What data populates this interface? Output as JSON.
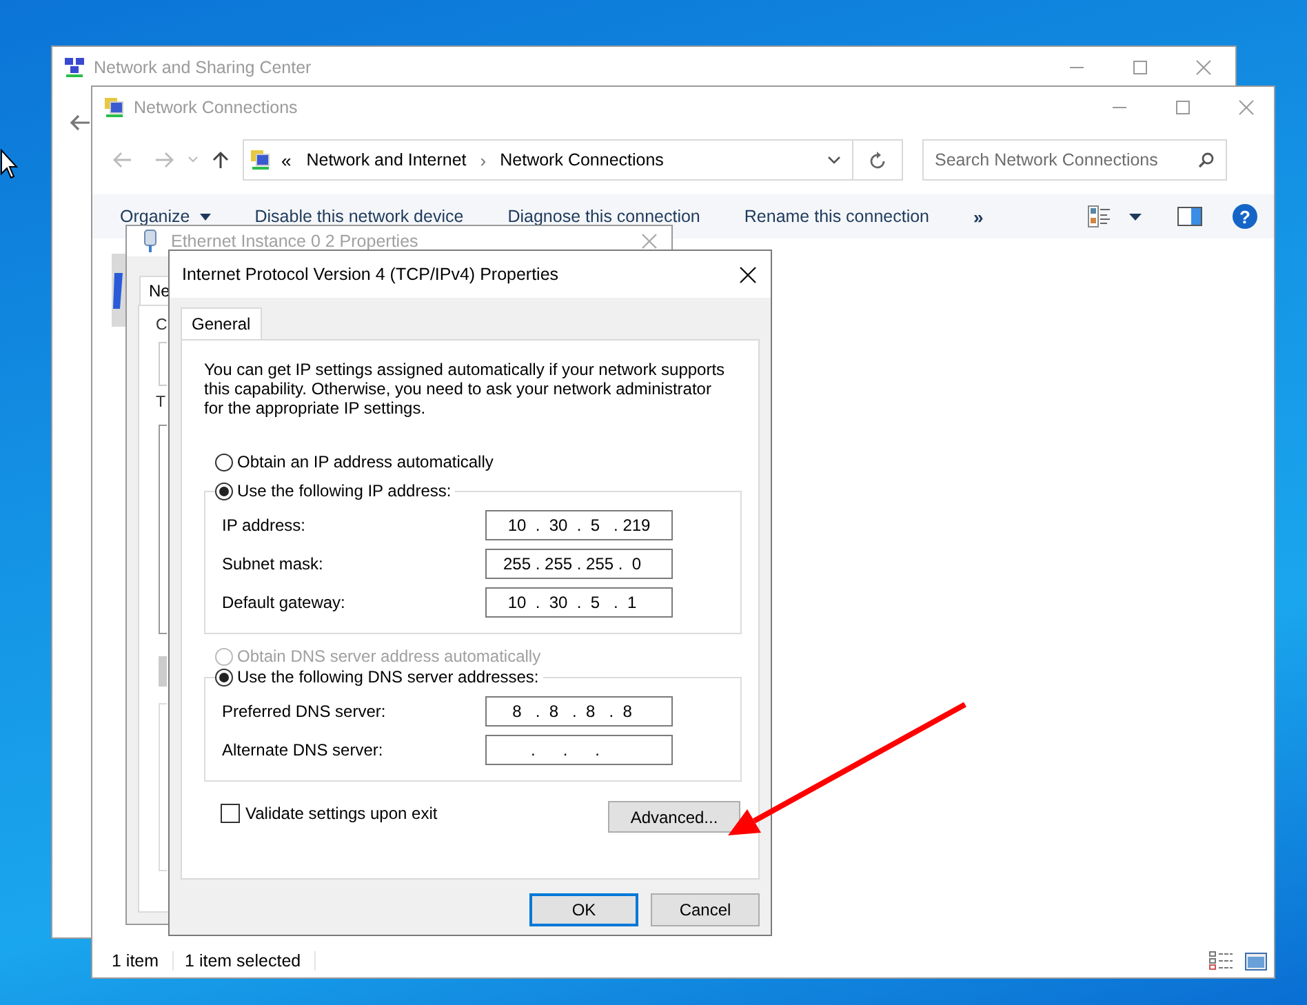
{
  "sharing_center_window": {
    "title": "Network and Sharing Center"
  },
  "connections_window": {
    "title": "Network Connections",
    "address": {
      "overflow_glyph": "«",
      "separator": "›",
      "crumbs": [
        "Network and Internet",
        "Network Connections"
      ]
    },
    "search": {
      "placeholder": "Search Network Connections"
    },
    "toolbar": [
      {
        "label": "Organize",
        "kind": "menu"
      },
      {
        "label": "Disable this network device",
        "kind": "command"
      },
      {
        "label": "Diagnose this connection",
        "kind": "command"
      },
      {
        "label": "Rename this connection",
        "kind": "command"
      },
      {
        "label": "»",
        "kind": "more"
      }
    ],
    "help_glyph": "?",
    "status_bar": [
      "1 item",
      "1 item selected"
    ]
  },
  "ethernet_window": {
    "title": "Ethernet Instance 0 2 Properties",
    "tab": "Ne",
    "labels": [
      "C",
      "T"
    ]
  },
  "ipv4_dialog": {
    "title": "Internet Protocol Version 4 (TCP/IPv4) Properties",
    "tabs": [
      {
        "label": "General",
        "selected": true
      }
    ],
    "intro": "You can get IP settings assigned automatically if your network supports this capability. Otherwise, you need to ask your network administrator for the appropriate IP settings.",
    "ip_options": [
      {
        "label": "Obtain an IP address automatically",
        "selected": false,
        "disabled": false
      },
      {
        "label": "Use the following IP address:",
        "selected": true,
        "disabled": false
      }
    ],
    "ip_fields": [
      {
        "label": "IP address:",
        "value": " 10  .  30  .  5   . 219"
      },
      {
        "label": "Subnet mask:",
        "value": "255 . 255 . 255 .  0"
      },
      {
        "label": "Default gateway:",
        "value": " 10  .  30  .  5   .  1"
      }
    ],
    "dns_options": [
      {
        "label": "Obtain DNS server address automatically",
        "selected": false,
        "disabled": true
      },
      {
        "label": "Use the following DNS server addresses:",
        "selected": true,
        "disabled": false
      }
    ],
    "dns_fields": [
      {
        "label": "Preferred DNS server:",
        "value": "  8   .  8   .  8   .  8"
      },
      {
        "label": "Alternate DNS server:",
        "value": "      .      .      ."
      }
    ],
    "validate": {
      "label": "Validate settings upon exit",
      "checked": false
    },
    "advanced_button": "Advanced...",
    "buttons": [
      {
        "label": "OK",
        "default": true
      },
      {
        "label": "Cancel",
        "default": false
      }
    ]
  }
}
